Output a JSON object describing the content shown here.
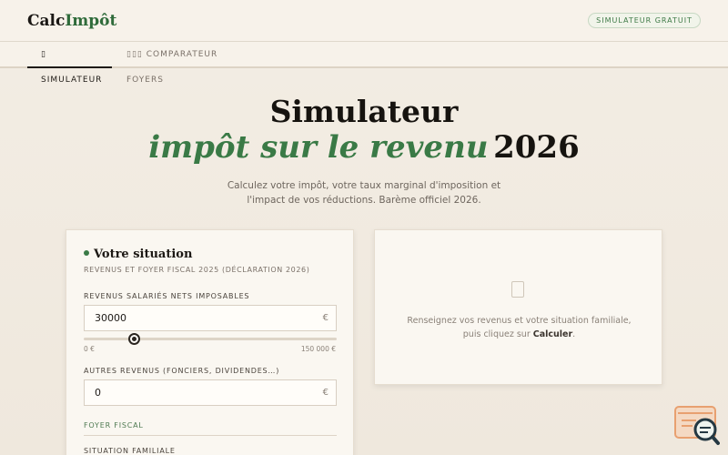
{
  "app": {
    "logo_part1": "Calc",
    "logo_part2": "Impôt",
    "badge": "SIMULATEUR GRATUIT"
  },
  "tabs": [
    {
      "label": "▯ SIMULATEUR",
      "active": true
    },
    {
      "label": "▯▯▯ COMPARATEUR FOYERS",
      "active": false
    }
  ],
  "hero": {
    "line1": "Simulateur",
    "line2_green": "impôt sur le revenu",
    "line2_year": "2026",
    "subtitle": "Calculez votre impôt, votre taux marginal d'imposition et l'impact de vos réductions. Barème officiel 2026."
  },
  "situation": {
    "title": "Votre situation",
    "subtitle": "REVENUS ET FOYER FISCAL 2025 (DÉCLARATION 2026)",
    "salary_label": "REVENUS SALARIÉS NETS IMPOSABLES",
    "salary_value": "30000",
    "salary_unit": "€",
    "slider_fraction": 0.2,
    "range_min": "0 €",
    "range_max": "150 000 €",
    "other_label": "AUTRES REVENUS (FONCIERS, DIVIDENDES…)",
    "other_value": "0",
    "other_unit": "€",
    "foyer_title": "FOYER FISCAL",
    "familial_label": "SITUATION FAMILIALE"
  },
  "result": {
    "icon": "document-icon",
    "text_before": "Renseignez vos revenus et votre situation familiale, puis cliquez sur ",
    "text_bold": "Calculer",
    "text_after": "."
  },
  "colors": {
    "accent_green": "#3a7a46",
    "background": "#f3ede4",
    "widget_orange": "#e8a070"
  }
}
